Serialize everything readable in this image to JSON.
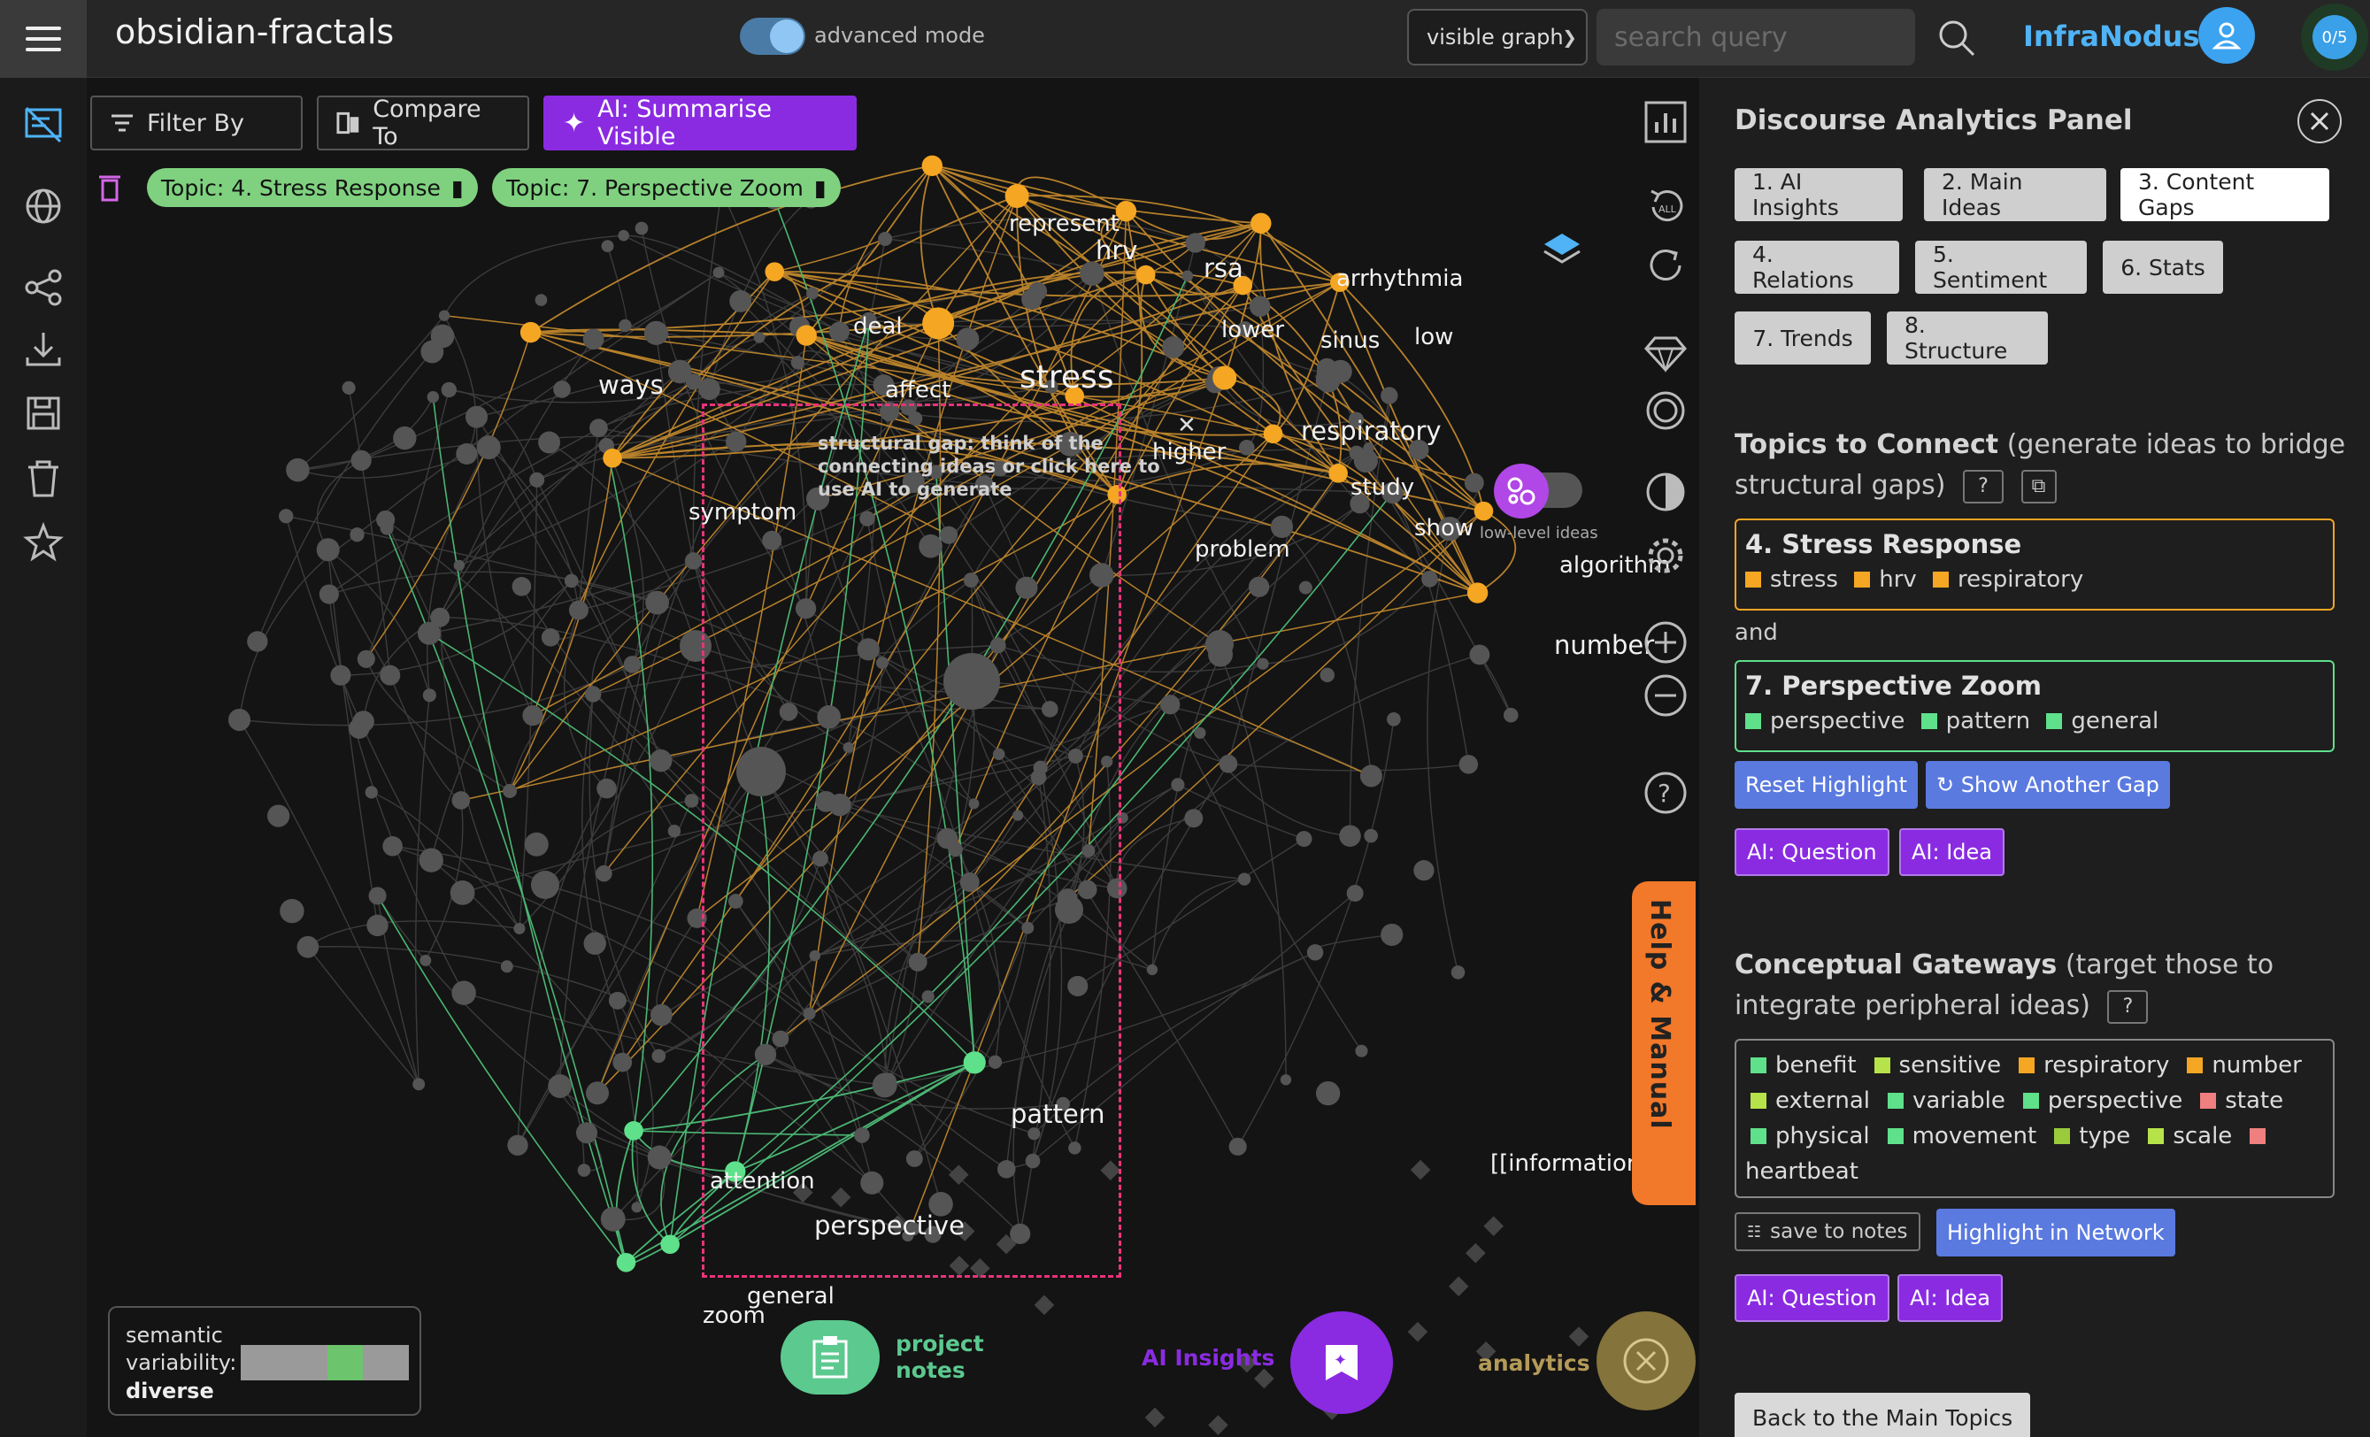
{
  "header": {
    "title": "obsidian-fractals",
    "advanced_mode_label": "advanced mode",
    "graph_select_value": "visible graph",
    "search_placeholder": "search query",
    "brand": "InfraNodus",
    "counter": "0/5"
  },
  "toolbar": {
    "filter_label": "Filter By",
    "compare_label": "Compare To",
    "ai_summarise_label": "AI: Summarise Visible",
    "topic_filters": [
      "Topic: 4. Stress Response",
      "Topic: 7. Perspective Zoom"
    ]
  },
  "graph": {
    "gap_text": "structural gap: think of the connecting ideas or click here to use AI to generate",
    "gap_close": "✕",
    "low_level_label": "low-level ideas",
    "orange_nodes": [
      "represent",
      "hrv",
      "rsa",
      "arrhythmia",
      "deal",
      "lower",
      "sinus",
      "low",
      "ways",
      "affect",
      "stress",
      "respiratory",
      "higher",
      "symptom",
      "study",
      "show",
      "problem",
      "algorithm",
      "number"
    ],
    "green_nodes": [
      "pattern",
      "attention",
      "perspective",
      "general",
      "zoom"
    ],
    "other_labels": [
      "[[information]]"
    ],
    "colors": {
      "orange": "#f5a623",
      "green": "#5fe08a",
      "edge_orange": "#b7812b",
      "edge_green": "#4bb673",
      "edge_grey": "#3c3c3c",
      "node_grey": "#555555",
      "gap": "#e8337a"
    }
  },
  "variability": {
    "label": "semantic variability:",
    "value": "diverse"
  },
  "bottom": {
    "notes_label": "project notes",
    "ai_insights_label": "AI Insights",
    "analytics_label": "analytics"
  },
  "help_tab": "Help & Manual",
  "panel": {
    "title": "Discourse Analytics Panel",
    "tabs": [
      "1. AI Insights",
      "2. Main Ideas",
      "3. Content Gaps",
      "4. Relations",
      "5. Sentiment",
      "6. Stats",
      "7. Trends",
      "8. Structure"
    ],
    "active_tab": "3. Content Gaps",
    "connect_title": "Topics to Connect",
    "connect_sub": "(generate ideas to bridge structural gaps)",
    "topic_a": {
      "name": "4. Stress Response",
      "keywords": [
        "stress",
        "hrv",
        "respiratory"
      ],
      "color": "#f5a623"
    },
    "and_label": "and",
    "topic_b": {
      "name": "7. Perspective Zoom",
      "keywords": [
        "perspective",
        "pattern",
        "general"
      ],
      "color": "#5fe08a"
    },
    "reset_highlight": "Reset Highlight",
    "show_another_gap": "↻ Show Another Gap",
    "ai_question": "AI: Question",
    "ai_idea": "AI: Idea",
    "gateways_title": "Conceptual Gateways",
    "gateways_sub": "(target those to integrate peripheral ideas)",
    "gateways": [
      {
        "word": "benefit",
        "color": "#5fe08a"
      },
      {
        "word": "sensitive",
        "color": "#b7e34a"
      },
      {
        "word": "respiratory",
        "color": "#f5a623"
      },
      {
        "word": "number",
        "color": "#f5a623"
      },
      {
        "word": "external",
        "color": "#b7e34a"
      },
      {
        "word": "variable",
        "color": "#5fe08a"
      },
      {
        "word": "perspective",
        "color": "#5fe08a"
      },
      {
        "word": "state",
        "color": "#f07f7f"
      },
      {
        "word": "physical",
        "color": "#5fe08a"
      },
      {
        "word": "movement",
        "color": "#5fe08a"
      },
      {
        "word": "type",
        "color": "#9acb3a"
      },
      {
        "word": "scale",
        "color": "#b7e34a"
      },
      {
        "word": "heartbeat",
        "color": "#f07f7f"
      }
    ],
    "save_notes": "save to notes",
    "highlight_network": "Highlight in Network",
    "back_main": "Back to the Main Topics"
  }
}
